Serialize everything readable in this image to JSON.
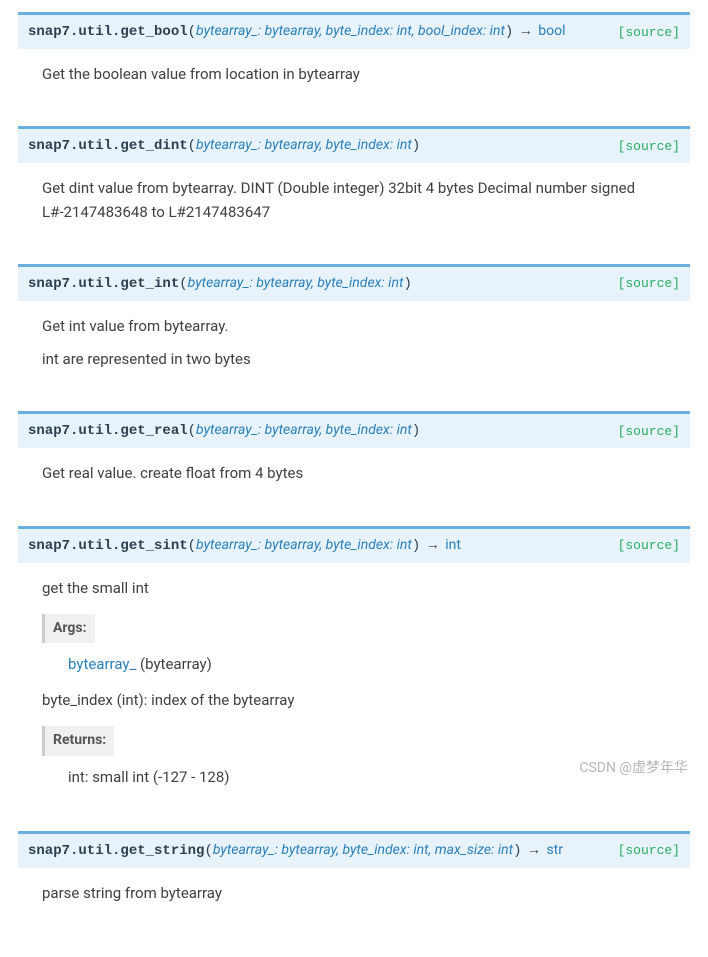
{
  "source_label": "[source]",
  "functions": [
    {
      "module": "snap7.util.",
      "name": "get_bool",
      "params": "bytearray_: bytearray, byte_index: int, bool_index: int",
      "return": "bool",
      "desc": [
        "Get the boolean value from location in bytearray"
      ]
    },
    {
      "module": "snap7.util.",
      "name": "get_dint",
      "params": "bytearray_: bytearray, byte_index: int",
      "return": "",
      "desc": [
        "Get dint value from bytearray. DINT (Double integer) 32bit 4 bytes Decimal number signed L#-2147483648 to L#2147483647"
      ]
    },
    {
      "module": "snap7.util.",
      "name": "get_int",
      "params": "bytearray_: bytearray, byte_index: int",
      "return": "",
      "desc": [
        "Get int value from bytearray.",
        "int are represented in two bytes"
      ]
    },
    {
      "module": "snap7.util.",
      "name": "get_real",
      "params": "bytearray_: bytearray, byte_index: int",
      "return": "",
      "desc": [
        "Get real value. create float from 4 bytes"
      ]
    },
    {
      "module": "snap7.util.",
      "name": "get_sint",
      "params": "bytearray_: bytearray, byte_index: int",
      "return": "int",
      "desc": [
        "get the small int"
      ],
      "args": {
        "header": "Args:",
        "param_link": "bytearray_",
        "param_rest": " (bytearray)",
        "line2": "byte_index (int): index of the bytearray"
      },
      "returns": {
        "header": "Returns:",
        "text": "int: small int (-127 - 128)"
      }
    },
    {
      "module": "snap7.util.",
      "name": "get_string",
      "params": "bytearray_: bytearray, byte_index: int, max_size: int",
      "return": "str",
      "desc": [
        "parse string from bytearray"
      ]
    }
  ],
  "watermark": "CSDN @虚梦年华"
}
